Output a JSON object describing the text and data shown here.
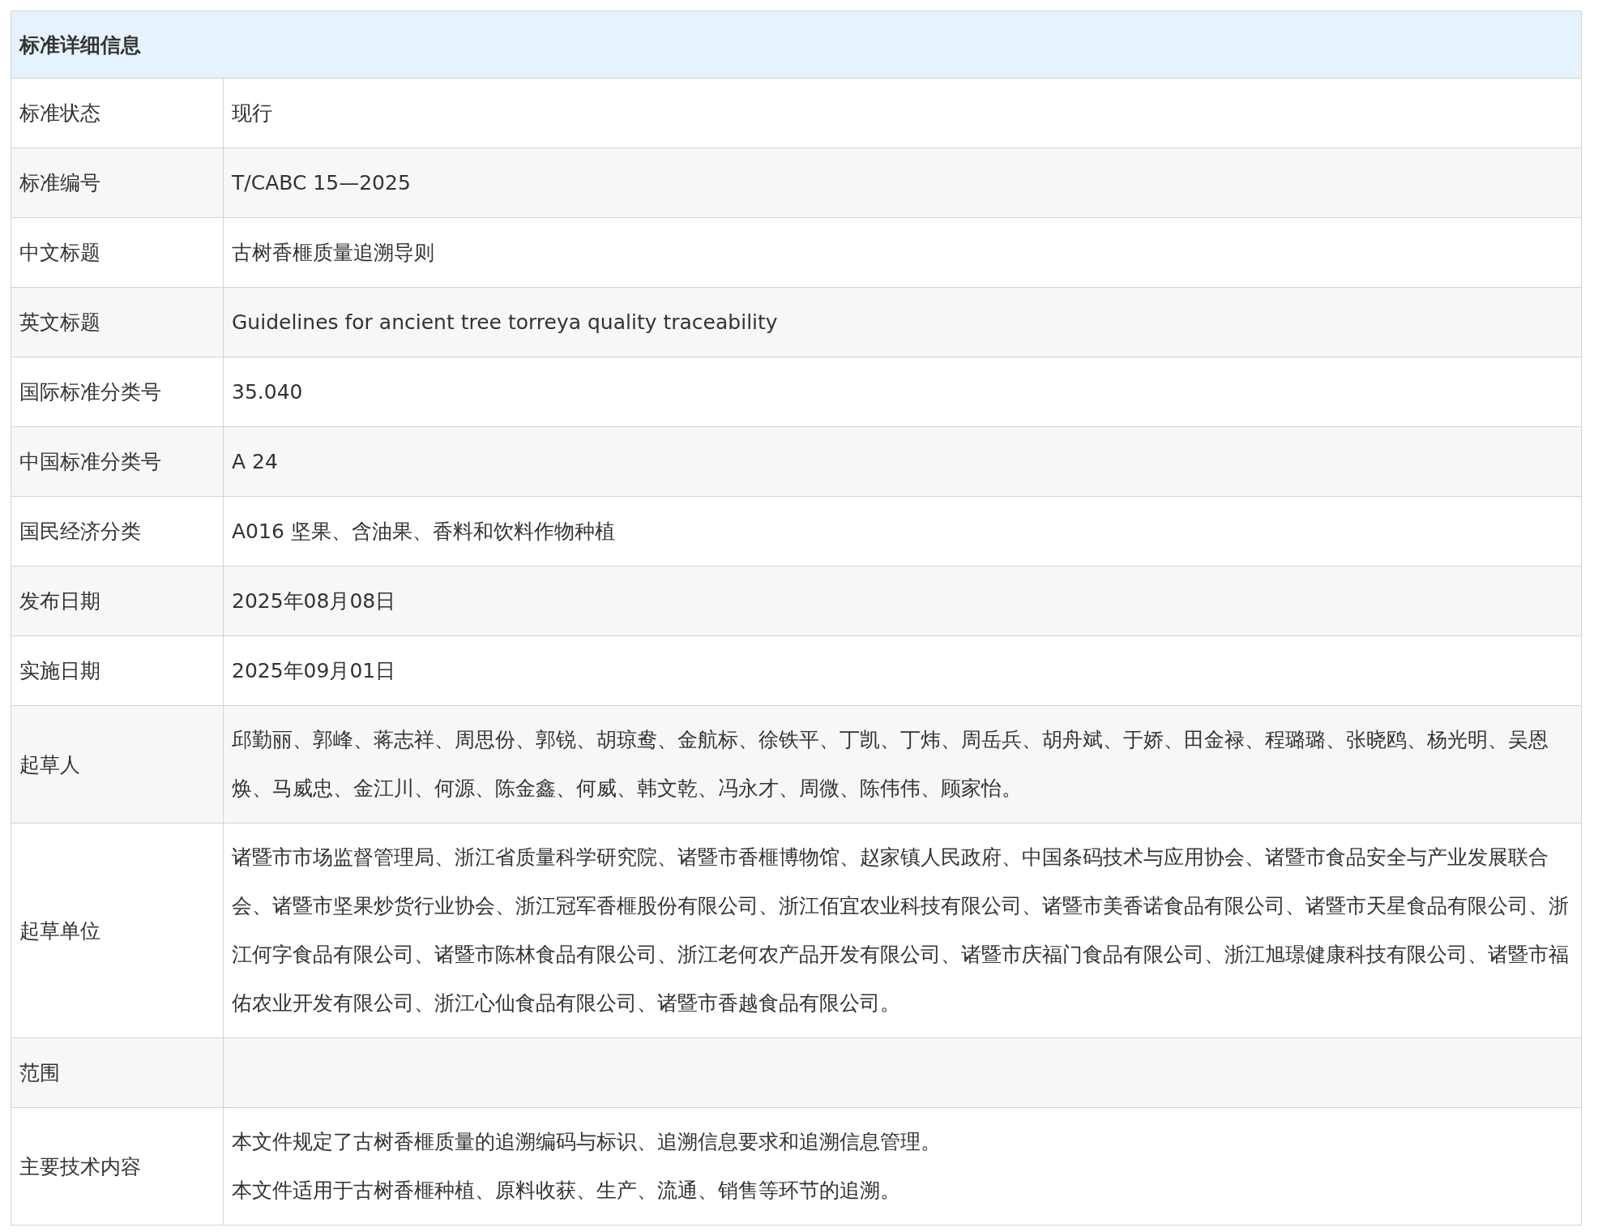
{
  "table": {
    "title": "标准详细信息",
    "rows": [
      {
        "label": "标准状态",
        "paragraphs": [
          "现行"
        ]
      },
      {
        "label": "标准编号",
        "paragraphs": [
          "T/CABC 15—2025"
        ]
      },
      {
        "label": "中文标题",
        "paragraphs": [
          "古树香榧质量追溯导则"
        ]
      },
      {
        "label": "英文标题",
        "paragraphs": [
          "Guidelines for ancient tree torreya quality traceability"
        ]
      },
      {
        "label": "国际标准分类号",
        "paragraphs": [
          "35.040"
        ]
      },
      {
        "label": "中国标准分类号",
        "paragraphs": [
          "A 24"
        ]
      },
      {
        "label": "国民经济分类",
        "paragraphs": [
          "A016 坚果、含油果、香料和饮料作物种植"
        ]
      },
      {
        "label": "发布日期",
        "paragraphs": [
          "2025年08月08日"
        ]
      },
      {
        "label": "实施日期",
        "paragraphs": [
          "2025年09月01日"
        ]
      },
      {
        "label": "起草人",
        "paragraphs": [
          "邱勤丽、郭峰、蒋志祥、周思份、郭锐、胡琼鸯、金航标、徐铁平、丁凯、丁炜、周岳兵、胡舟斌、于娇、田金禄、程璐璐、张晓鸥、杨光明、吴恩焕、马威忠、金江川、何源、陈金鑫、何威、韩文乾、冯永才、周微、陈伟伟、顾家怡。"
        ]
      },
      {
        "label": "起草单位",
        "paragraphs": [
          "诸暨市市场监督管理局、浙江省质量科学研究院、诸暨市香榧博物馆、赵家镇人民政府、中国条码技术与应用协会、诸暨市食品安全与产业发展联合会、诸暨市坚果炒货行业协会、浙江冠军香榧股份有限公司、浙江佰宜农业科技有限公司、诸暨市美香诺食品有限公司、诸暨市天星食品有限公司、浙江何字食品有限公司、诸暨市陈林食品有限公司、浙江老何农产品开发有限公司、诸暨市庆福门食品有限公司、浙江旭璟健康科技有限公司、诸暨市福佑农业开发有限公司、浙江心仙食品有限公司、诸暨市香越食品有限公司。"
        ]
      },
      {
        "label": "范围",
        "paragraphs": []
      },
      {
        "label": "主要技术内容",
        "paragraphs": [
          "本文件规定了古树香榧质量的追溯编码与标识、追溯信息要求和追溯信息管理。",
          "本文件适用于古树香榧种植、原料收获、生产、流通、销售等环节的追溯。"
        ]
      }
    ]
  }
}
